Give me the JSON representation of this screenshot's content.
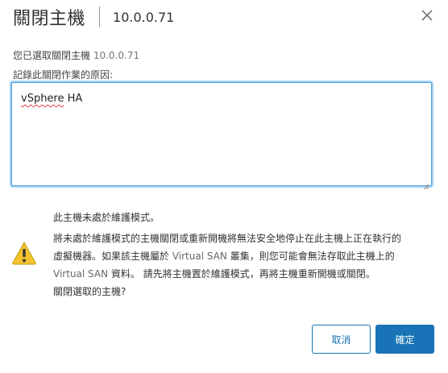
{
  "dialog": {
    "title": "關閉主機",
    "host": "10.0.0.71",
    "close_icon": "close-icon"
  },
  "intro": {
    "prefix": "您已選取關閉主機",
    "host": "10.0.0.71"
  },
  "reason": {
    "label": "記錄此關閉作業的原因:",
    "value_word1": "vSphere",
    "value_word2": "HA"
  },
  "warning": {
    "icon": "warning-triangle-icon",
    "heading": "此主機未處於維護模式。",
    "line1": "將未處於維護模式的主機關閉或重新開機將無法安全地停止在此主機上正在執行的",
    "line2_a": "虛擬機器。如果該主機屬於",
    "line2_en": "Virtual SAN",
    "line2_b": "叢集，則您可能會無法存取此主機上的",
    "line3_en": "Virtual SAN",
    "line3_b": "資料。 請先將主機置於維護模式，再將主機重新開機或關閉。",
    "question": "關閉選取的主機?"
  },
  "buttons": {
    "cancel": "取消",
    "ok": "確定"
  },
  "colors": {
    "primary": "#1874b6",
    "focus_border": "#4e9fd8",
    "warning_yellow": "#f5c42c"
  }
}
